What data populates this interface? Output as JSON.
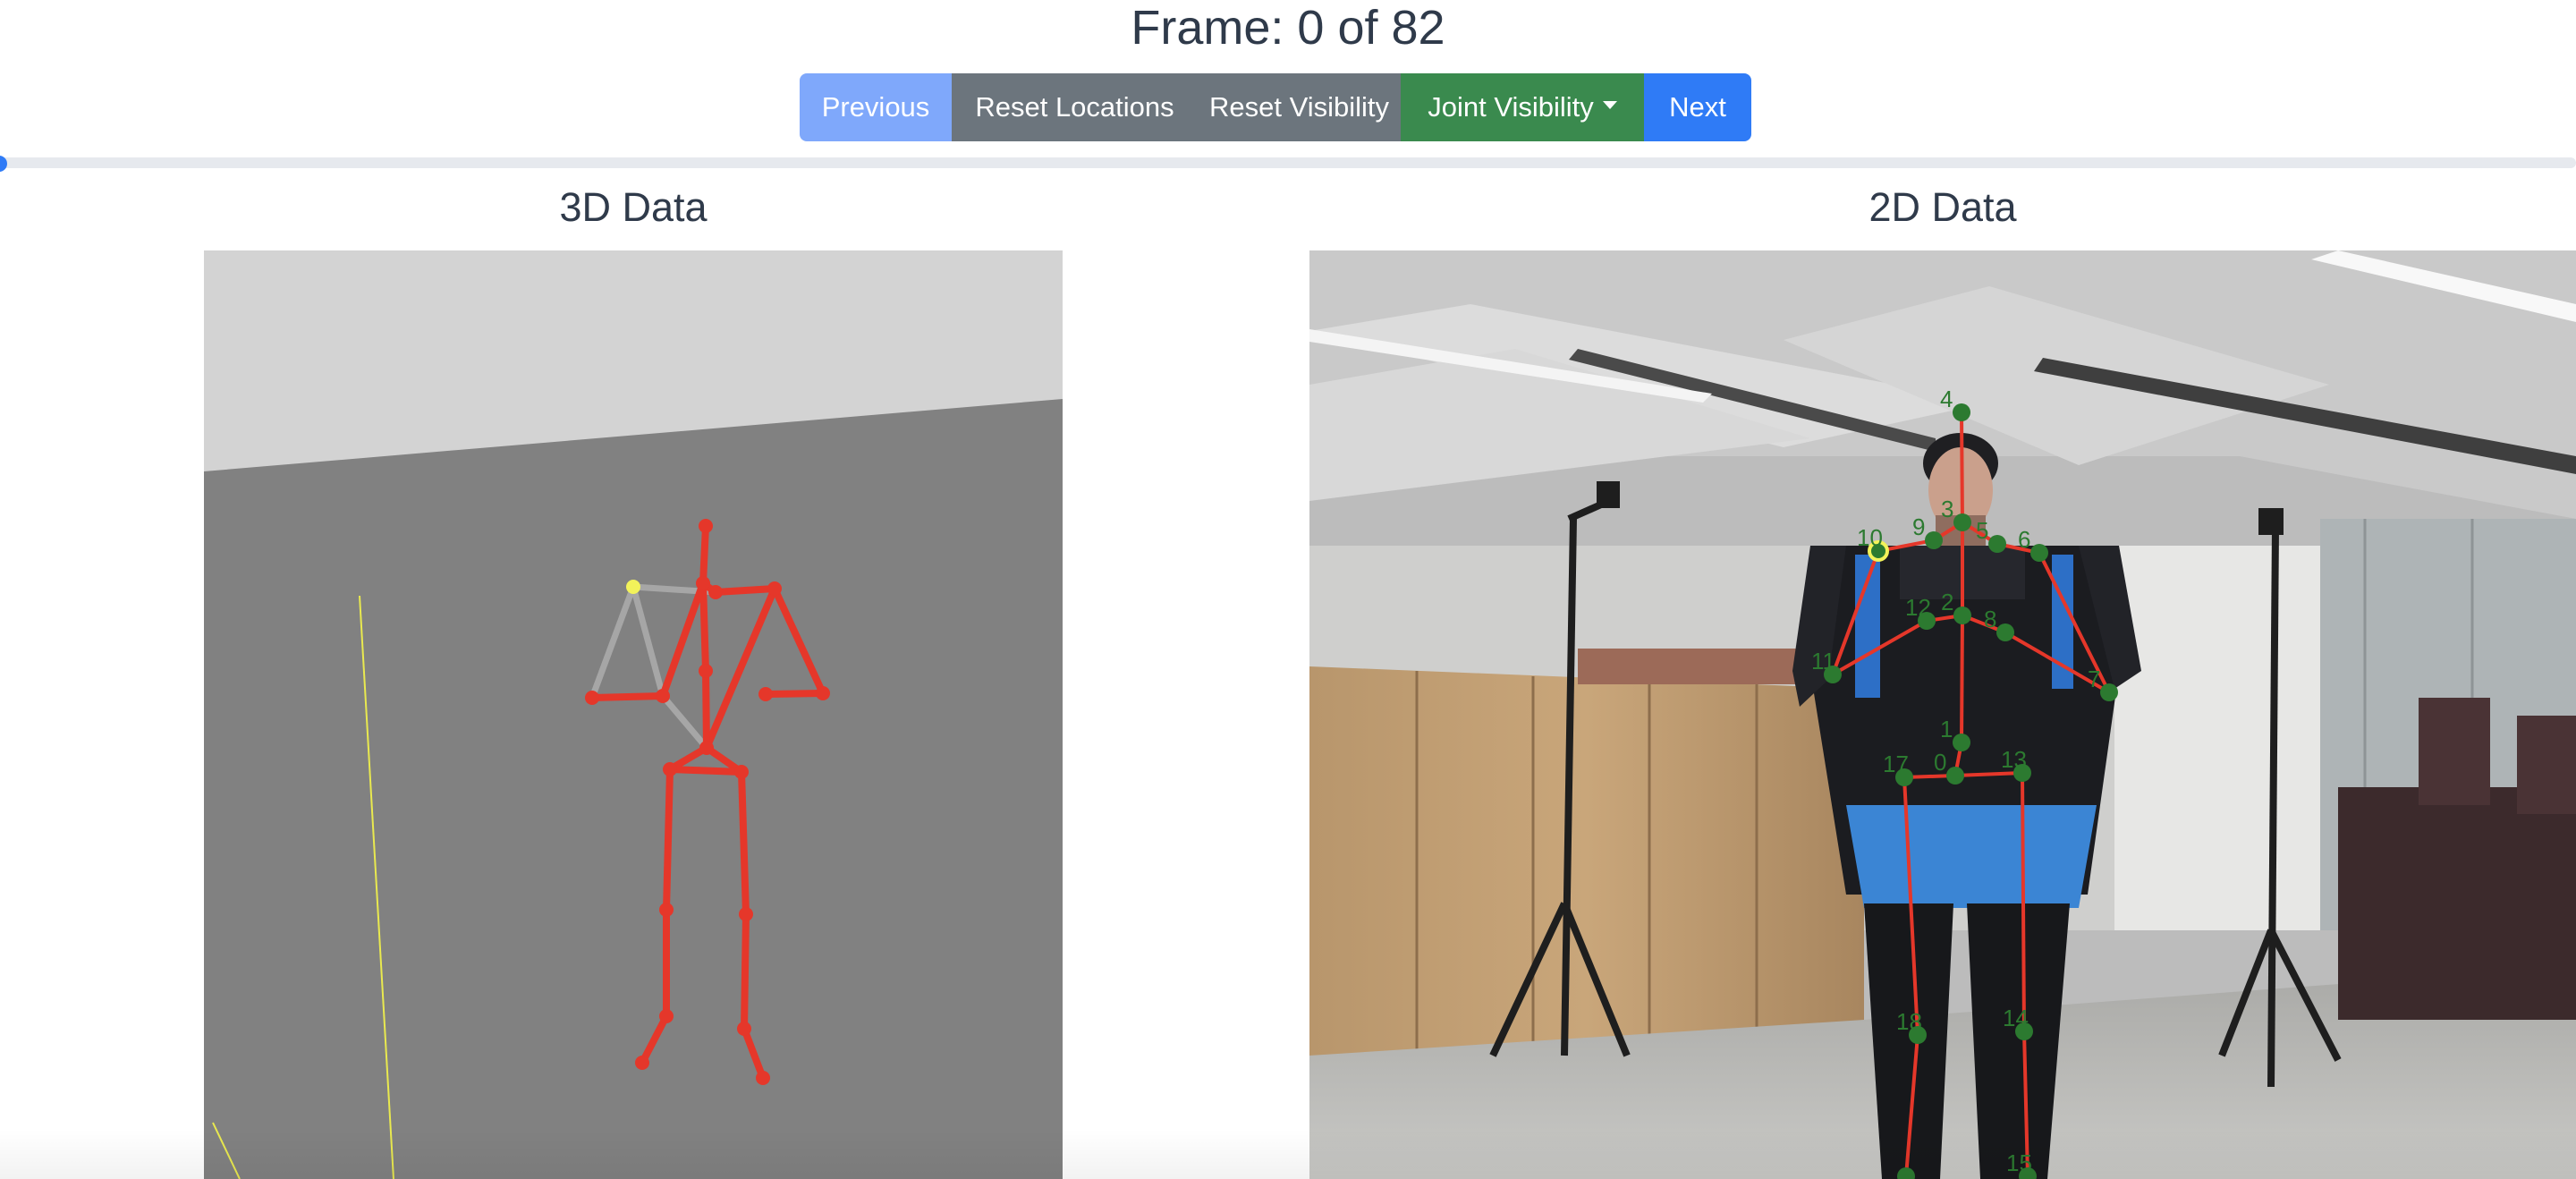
{
  "header": {
    "frame_text": "Frame: 0 of 82"
  },
  "toolbar": {
    "previous_label": "Previous",
    "reset_locations_label": "Reset Locations",
    "reset_visibility_label": "Reset Visibility",
    "joint_visibility_label": "Joint Visibility",
    "next_label": "Next"
  },
  "slider": {
    "value": 0,
    "max": 82
  },
  "panels": {
    "left_title": "3D Data",
    "right_title": "2D Data"
  },
  "joint_labels": [
    "0",
    "1",
    "2",
    "3",
    "4",
    "5",
    "6",
    "7",
    "8",
    "9",
    "10",
    "11",
    "12",
    "13",
    "14",
    "15",
    "17",
    "18"
  ],
  "colors": {
    "primary": "#2f7bf6",
    "primary_disabled": "#7fa8fb",
    "secondary": "#6c757d",
    "success": "#3a8a4e",
    "skeleton": "#e5372a",
    "joint": "#2c7a30",
    "highlight": "#f2f25a"
  }
}
